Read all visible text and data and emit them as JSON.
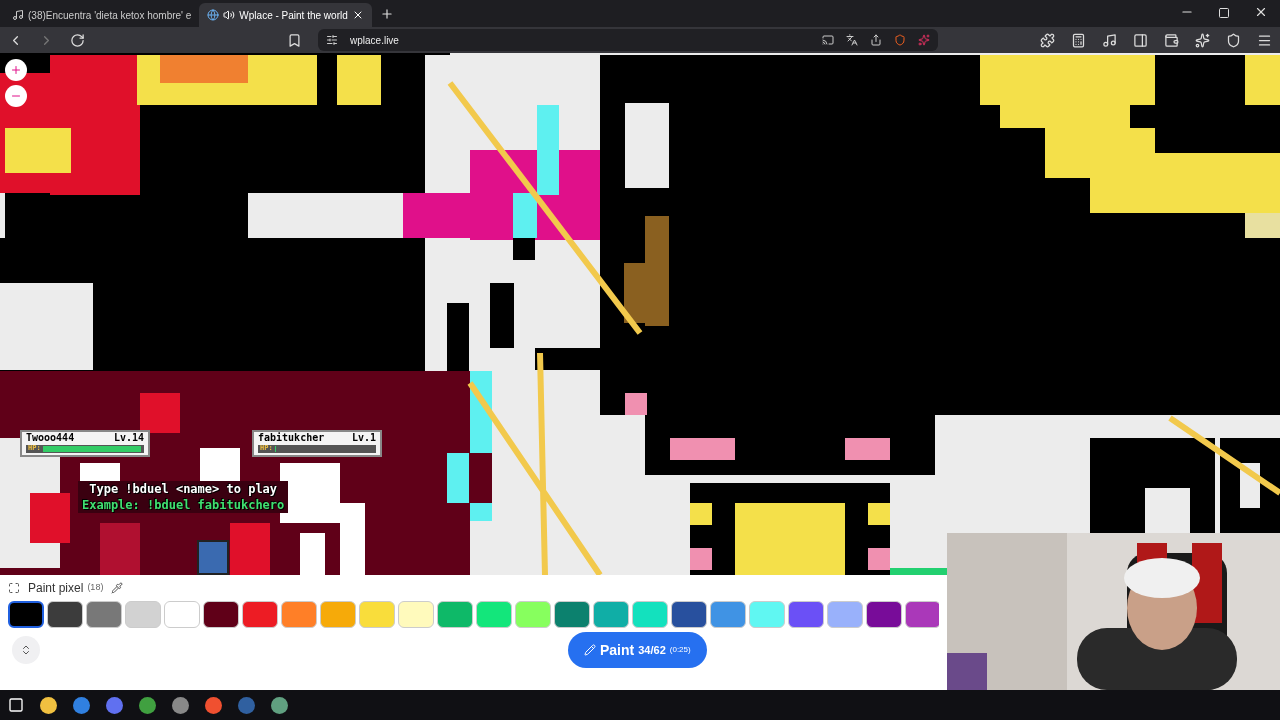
{
  "browser": {
    "tabs": [
      {
        "title": "(38)Encuentra 'dieta ketox hombre' e",
        "selected": false
      },
      {
        "title": "Wplace - Paint the world",
        "selected": true
      }
    ],
    "url": "wplace.live"
  },
  "duel": {
    "players": [
      {
        "name": "Twooo444",
        "level": "Lv.14",
        "hp_label": "HP:",
        "hp": {
          "level": 0.97
        }
      },
      {
        "name": "fabitukcher",
        "level": "Lv.1",
        "hp_label": "HP:",
        "hp": {
          "level": 0
        }
      }
    ],
    "instruction": "Type !bduel <name> to play",
    "example": "Example: !bduel fabitukchero"
  },
  "paint_panel": {
    "title": "Paint pixel",
    "count": "(18)",
    "palette": [
      {
        "color": "#000000",
        "selected": true
      },
      {
        "color": "#3c3c3c",
        "selected": false
      },
      {
        "color": "#787878",
        "selected": false
      },
      {
        "color": "#d2d2d2",
        "selected": false
      },
      {
        "color": "#ffffff",
        "selected": false
      },
      {
        "color": "#600018",
        "selected": false
      },
      {
        "color": "#ed1c24",
        "selected": false
      },
      {
        "color": "#ff7f27",
        "selected": false
      },
      {
        "color": "#f6aa09",
        "selected": false
      },
      {
        "color": "#f9dd3b",
        "selected": false
      },
      {
        "color": "#fffabc",
        "selected": false
      },
      {
        "color": "#0eb968",
        "selected": false
      },
      {
        "color": "#13e67b",
        "selected": false
      },
      {
        "color": "#87ff5e",
        "selected": false
      },
      {
        "color": "#0c816e",
        "selected": false
      },
      {
        "color": "#10aea6",
        "selected": false
      },
      {
        "color": "#13e1be",
        "selected": false
      },
      {
        "color": "#28509e",
        "selected": false
      },
      {
        "color": "#4093e4",
        "selected": false
      },
      {
        "color": "#60f7f2",
        "selected": false
      },
      {
        "color": "#6b50f6",
        "selected": false
      },
      {
        "color": "#99b1fb",
        "selected": false
      },
      {
        "color": "#780c99",
        "selected": false
      },
      {
        "color": "#aa38b9",
        "selected": false
      }
    ],
    "paint_button": {
      "label": "Paint",
      "charges": "34/62",
      "timer": "(0:25)"
    }
  }
}
